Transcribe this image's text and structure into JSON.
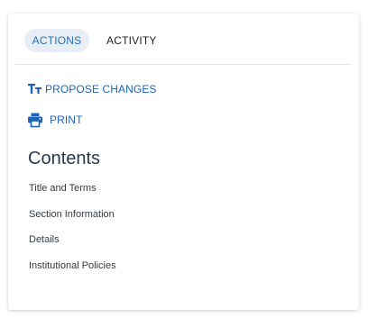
{
  "tabs": [
    {
      "label": "ACTIONS",
      "active": true
    },
    {
      "label": "ACTIVITY",
      "active": false
    }
  ],
  "actions": [
    {
      "label": "PROPOSE CHANGES",
      "icon": "text-format-icon"
    },
    {
      "label": "PRINT",
      "icon": "printer-icon"
    }
  ],
  "contents": {
    "title": "Contents",
    "items": [
      "Title and Terms",
      "Section Information",
      "Details",
      "Institutional Policies"
    ]
  },
  "colors": {
    "accent": "#1f63b8",
    "active_tab_bg": "#e7eef6",
    "heading": "#2a3850"
  }
}
